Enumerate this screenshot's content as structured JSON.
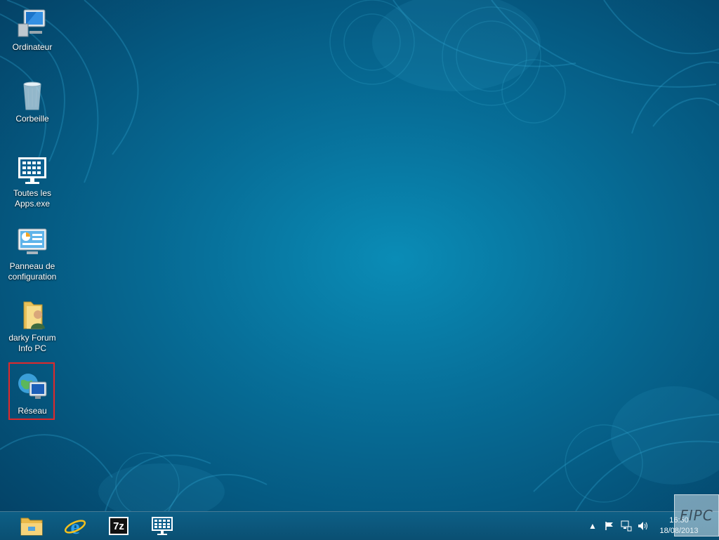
{
  "desktop": {
    "icons": [
      {
        "label": "Ordinateur",
        "icon": "computer-icon"
      },
      {
        "label": "Corbeille",
        "icon": "recycle-bin-icon"
      },
      {
        "label": "Toutes les Apps.exe",
        "icon": "apps-grid-icon"
      },
      {
        "label": "Panneau de configuration",
        "icon": "control-panel-icon"
      },
      {
        "label": "darky Forum Info PC",
        "icon": "user-folder-icon"
      },
      {
        "label": "Réseau",
        "icon": "network-icon"
      }
    ],
    "selected": "Réseau",
    "highlight_color": "#e0292b"
  },
  "taskbar": {
    "pinned": [
      {
        "name": "File Explorer",
        "icon": "folder-icon"
      },
      {
        "name": "Internet Explorer",
        "icon": "ie-icon"
      },
      {
        "name": "7-Zip",
        "icon": "seven-zip-icon",
        "text": "7z"
      },
      {
        "name": "Toutes les Apps",
        "icon": "apps-grid-icon"
      }
    ],
    "tray": {
      "icons": [
        "chevron-up-icon",
        "flag-icon",
        "network-status-icon",
        "volume-icon"
      ],
      "time": "16:50",
      "date": "18/08/2013"
    }
  },
  "watermark": "FIPC"
}
